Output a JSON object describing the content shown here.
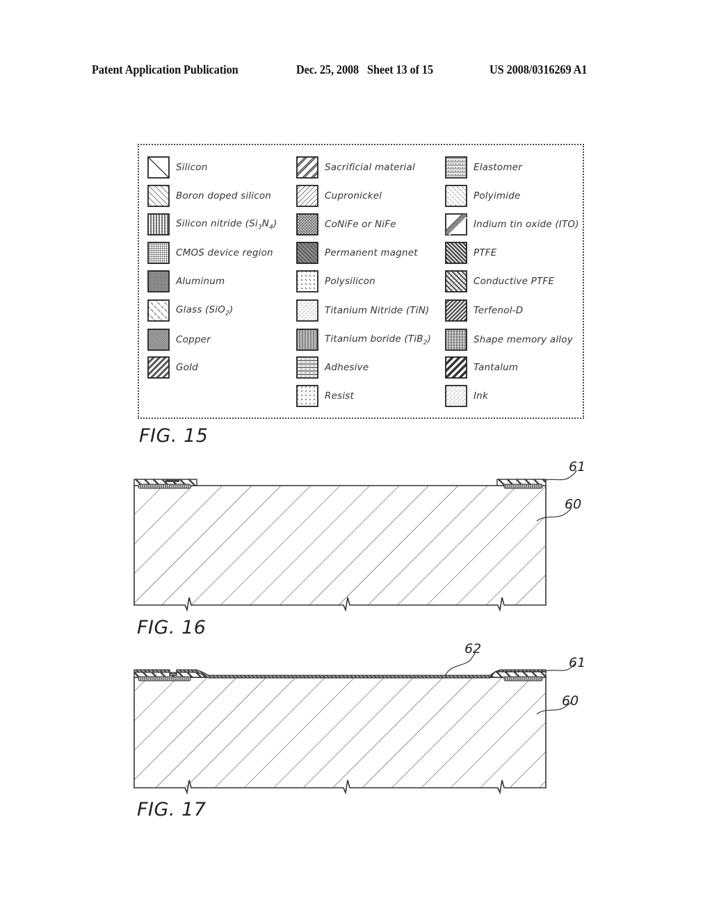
{
  "header": {
    "publication_type": "Patent Application Publication",
    "date_sheet": "Dec. 25, 2008   Sheet 13 of 15",
    "patent_number": "US 2008/0316269 A1"
  },
  "figures": [
    {
      "id": "fig15",
      "label": "FIG. 15",
      "type": "material-legend"
    },
    {
      "id": "fig16",
      "label": "FIG. 16",
      "type": "cross-section",
      "reference_numerals": [
        "61",
        "60"
      ]
    },
    {
      "id": "fig17",
      "label": "FIG. 17",
      "type": "cross-section",
      "reference_numerals": [
        "62",
        "61",
        "60"
      ]
    }
  ],
  "legend": {
    "columns": [
      [
        {
          "label": "Silicon",
          "pattern": "silicon"
        },
        {
          "label": "Boron doped silicon",
          "pattern": "boron"
        },
        {
          "label": "Silicon nitride (Si3N4)",
          "pattern": "nitride"
        },
        {
          "label": "CMOS device region",
          "pattern": "cmos"
        },
        {
          "label": "Aluminum",
          "pattern": "aluminum"
        },
        {
          "label": "Glass (SiO2)",
          "pattern": "glass"
        },
        {
          "label": "Copper",
          "pattern": "copper"
        },
        {
          "label": "Gold",
          "pattern": "gold"
        }
      ],
      [
        {
          "label": "Sacrificial material",
          "pattern": "sacrificial"
        },
        {
          "label": "Cupronickel",
          "pattern": "cupronickel"
        },
        {
          "label": "CoNiFe or NiFe",
          "pattern": "conife"
        },
        {
          "label": "Permanent magnet",
          "pattern": "magnet"
        },
        {
          "label": "Polysilicon",
          "pattern": "polysilicon"
        },
        {
          "label": "Titanium Nitride (TiN)",
          "pattern": "tin"
        },
        {
          "label": "Titanium boride (TiB2)",
          "pattern": "tib2"
        },
        {
          "label": "Adhesive",
          "pattern": "adhesive"
        },
        {
          "label": "Resist",
          "pattern": "resist"
        }
      ],
      [
        {
          "label": "Elastomer",
          "pattern": "elastomer"
        },
        {
          "label": "Polyimide",
          "pattern": "polyimide"
        },
        {
          "label": "Indium tin oxide (ITO)",
          "pattern": "ito"
        },
        {
          "label": "PTFE",
          "pattern": "ptfe"
        },
        {
          "label": "Conductive PTFE",
          "pattern": "cptfe"
        },
        {
          "label": "Terfenol-D",
          "pattern": "terfenol"
        },
        {
          "label": "Shape memory alloy",
          "pattern": "sma"
        },
        {
          "label": "Tantalum",
          "pattern": "tantalum"
        },
        {
          "label": "Ink",
          "pattern": "ink"
        }
      ]
    ]
  }
}
